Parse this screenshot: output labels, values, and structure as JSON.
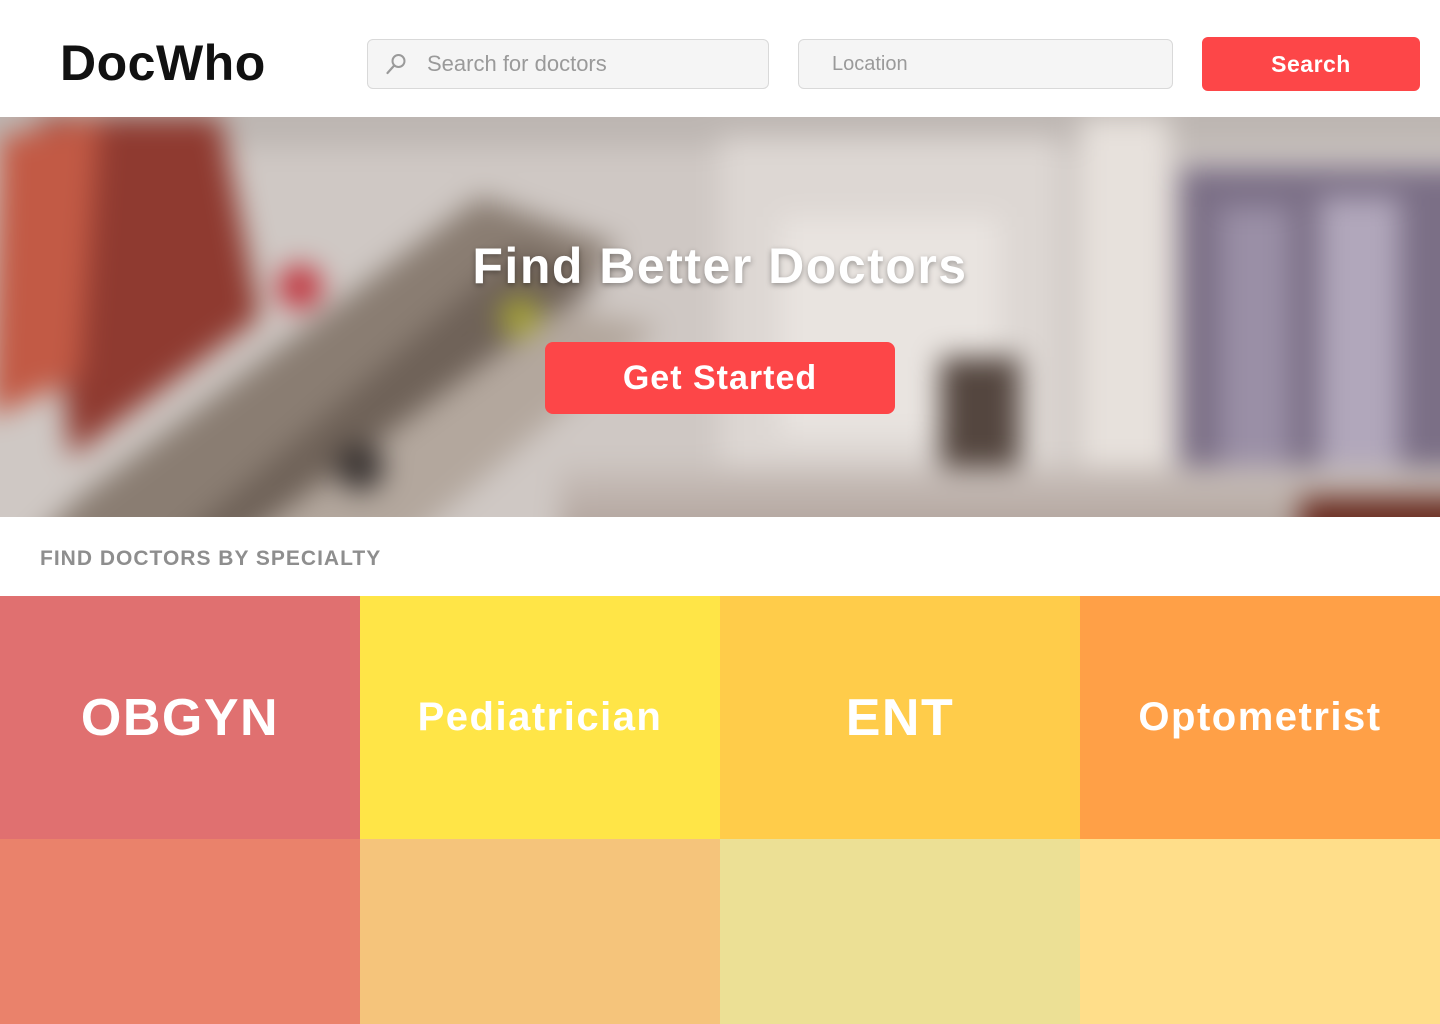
{
  "header": {
    "logo": "DocWho",
    "search": {
      "placeholder": "Search for doctors",
      "icon": "search-icon"
    },
    "location": {
      "placeholder": "Location"
    },
    "search_button": "Search"
  },
  "hero": {
    "title": "Find Better Doctors",
    "cta": "Get Started"
  },
  "specialties": {
    "heading": "FIND DOCTORS BY SPECIALTY",
    "tiles": [
      {
        "label": "OBGYN",
        "color": "#e07070"
      },
      {
        "label": "Pediatrician",
        "color": "#ffe547"
      },
      {
        "label": "ENT",
        "color": "#ffcc4a"
      },
      {
        "label": "Optometrist",
        "color": "#ffa047"
      }
    ],
    "tiles_row2": [
      {
        "label": "",
        "color": "#ea826b"
      },
      {
        "label": "",
        "color": "#f5c47b"
      },
      {
        "label": "",
        "color": "#ece095"
      },
      {
        "label": "",
        "color": "#ffde8a"
      }
    ]
  },
  "colors": {
    "accent": "#fd4648",
    "logo": "#111111",
    "heading_gray": "#8e8e8e"
  }
}
